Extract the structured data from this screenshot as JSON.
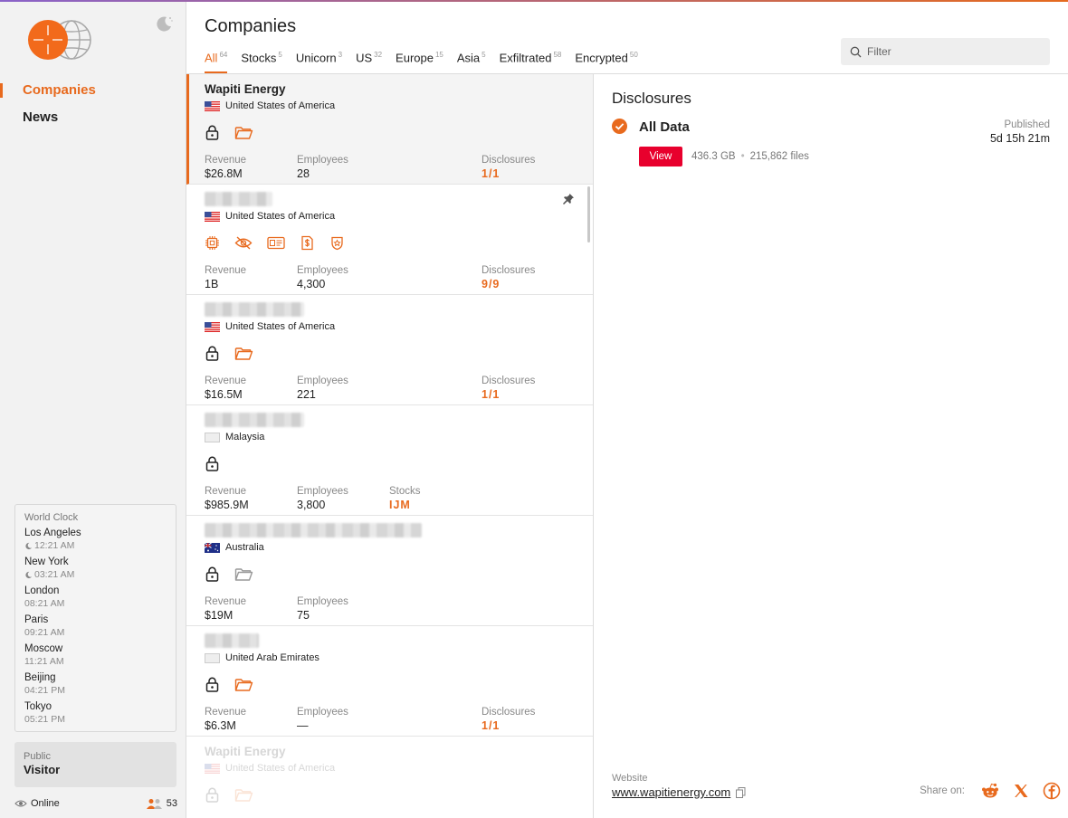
{
  "colors": {
    "accent": "#e86a1e",
    "danger": "#e8002d"
  },
  "header": {
    "title": "Companies",
    "filter_placeholder": "Filter",
    "tabs": [
      {
        "label": "All",
        "count": "64"
      },
      {
        "label": "Stocks",
        "count": "5"
      },
      {
        "label": "Unicorn",
        "count": "3"
      },
      {
        "label": "US",
        "count": "32"
      },
      {
        "label": "Europe",
        "count": "15"
      },
      {
        "label": "Asia",
        "count": "5"
      },
      {
        "label": "Exfiltrated",
        "count": "58"
      },
      {
        "label": "Encrypted",
        "count": "50"
      }
    ]
  },
  "sidebar": {
    "nav": [
      {
        "label": "Companies"
      },
      {
        "label": "News"
      }
    ],
    "clock": {
      "title": "World Clock",
      "cities": [
        {
          "city": "Los Angeles",
          "time": "12:21 AM",
          "night": true
        },
        {
          "city": "New York",
          "time": "03:21 AM",
          "night": true
        },
        {
          "city": "London",
          "time": "08:21 AM",
          "night": false
        },
        {
          "city": "Paris",
          "time": "09:21 AM",
          "night": false
        },
        {
          "city": "Moscow",
          "time": "11:21 AM",
          "night": false
        },
        {
          "city": "Beijing",
          "time": "04:21 PM",
          "night": false
        },
        {
          "city": "Tokyo",
          "time": "05:21 PM",
          "night": false
        }
      ]
    },
    "visitor": {
      "role": "Public",
      "name": "Visitor"
    },
    "status": {
      "online": "Online",
      "count": "53"
    }
  },
  "labels": {
    "revenue": "Revenue",
    "employees": "Employees",
    "disclosures": "Disclosures",
    "stocks": "Stocks"
  },
  "companies": [
    {
      "name": "Wapiti Energy",
      "country": "United States of America",
      "revenue": "$26.8M",
      "employees": "28",
      "disclosures": "1/1"
    },
    {
      "name": "",
      "country": "United States of America",
      "revenue": "1B",
      "employees": "4,300",
      "disclosures": "9/9"
    },
    {
      "name": "",
      "country": "United States of America",
      "revenue": "$16.5M",
      "employees": "221",
      "disclosures": "1/1"
    },
    {
      "name": "",
      "country": "Malaysia",
      "revenue": "$985.9M",
      "employees": "3,800",
      "stocks": "IJM"
    },
    {
      "name": "",
      "country": "Australia",
      "revenue": "$19M",
      "employees": "75"
    },
    {
      "name": "",
      "country": "United Arab Emirates",
      "revenue": "$6.3M",
      "employees": "—",
      "disclosures": "1/1"
    },
    {
      "name": "Wapiti Energy",
      "country": "United States of America"
    }
  ],
  "details": {
    "title": "Disclosures",
    "item": {
      "name": "All Data",
      "published_label": "Published",
      "published_value": "5d 15h 21m",
      "view_label": "View",
      "size": "436.3 GB",
      "files": "215,862 files"
    },
    "website_label": "Website",
    "website": "www.wapitienergy.com",
    "share_label": "Share on:"
  }
}
